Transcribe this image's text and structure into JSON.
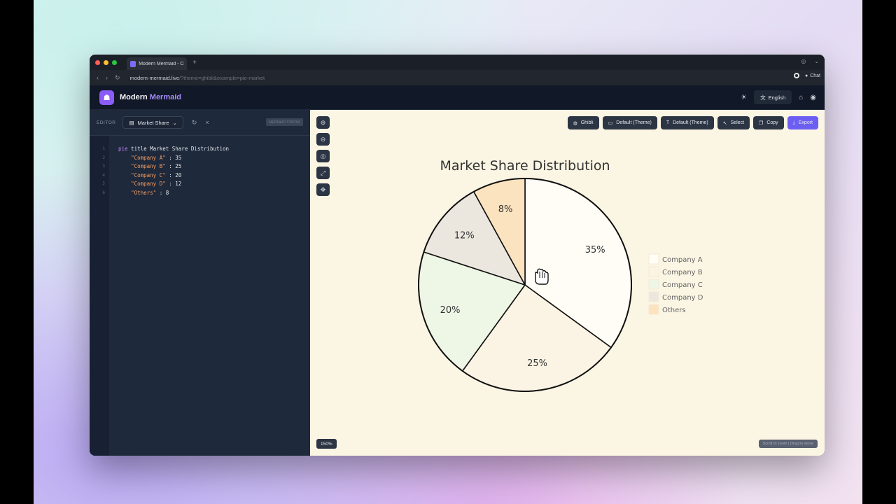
{
  "browser": {
    "tab_title": "Modern Mermaid - Onl",
    "new_tab": "+",
    "url_main": "modern-mermaid.live",
    "url_rest": "/?theme=ghibli&example=pie-market",
    "chat_label": "Chat"
  },
  "app": {
    "brand_main": "Modern ",
    "brand_accent": "Mermaid",
    "language": "English"
  },
  "editor": {
    "label": "EDITOR",
    "selected_example": "Market Share",
    "badge": "MERMAID SYNTAX",
    "lines": [
      {
        "n": "1",
        "kw": "pie",
        "rest": " title Market Share Distribution"
      },
      {
        "n": "2",
        "str": "\"Company A\"",
        "rest": " : 35"
      },
      {
        "n": "3",
        "str": "\"Company B\"",
        "rest": " : 25"
      },
      {
        "n": "4",
        "str": "\"Company C\"",
        "rest": " : 20"
      },
      {
        "n": "5",
        "str": "\"Company D\"",
        "rest": " : 12"
      },
      {
        "n": "6",
        "str": "\"Others\"",
        "rest": " : 8"
      }
    ]
  },
  "canvas_toolbar": {
    "theme": "Ghibli",
    "bg": "Default (Theme)",
    "font": "Default (Theme)",
    "select": "Select",
    "copy": "Copy",
    "export": "Export"
  },
  "zoom_level": "150%",
  "hint": "Scroll to zoom | Drag to move",
  "chart_data": {
    "type": "pie",
    "title": "Market Share Distribution",
    "categories": [
      "Company A",
      "Company B",
      "Company C",
      "Company D",
      "Others"
    ],
    "values": [
      35,
      25,
      20,
      12,
      8
    ],
    "labels": [
      "35%",
      "25%",
      "20%",
      "12%",
      "8%"
    ],
    "colors": [
      "#fffdf6",
      "#fbf3e3",
      "#eef6e6",
      "#ebe7df",
      "#fbe3bf"
    ],
    "legend": "right"
  }
}
